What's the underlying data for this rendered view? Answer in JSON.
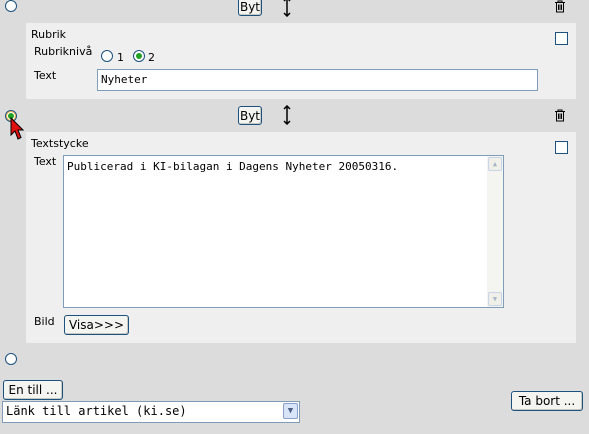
{
  "top_row": {
    "swap_button": "Byt"
  },
  "rubrik_block": {
    "title": "Rubrik",
    "level_label": "Rubriknivå",
    "level_options": [
      "1",
      "2"
    ],
    "level_selected": "2",
    "text_label": "Text",
    "text_value": "Nyheter"
  },
  "second_row": {
    "swap_button": "Byt"
  },
  "textstycke_block": {
    "title": "Textstycke",
    "text_label": "Text",
    "text_value": "Publicerad i KI-bilagan i Dagens Nyheter 20050316.",
    "image_label": "Bild",
    "image_button": "Visa>>>"
  },
  "footer": {
    "add_button": "En till ...",
    "remove_button": "Ta bort ...",
    "select_value": "Länk till artikel (ki.se)"
  }
}
